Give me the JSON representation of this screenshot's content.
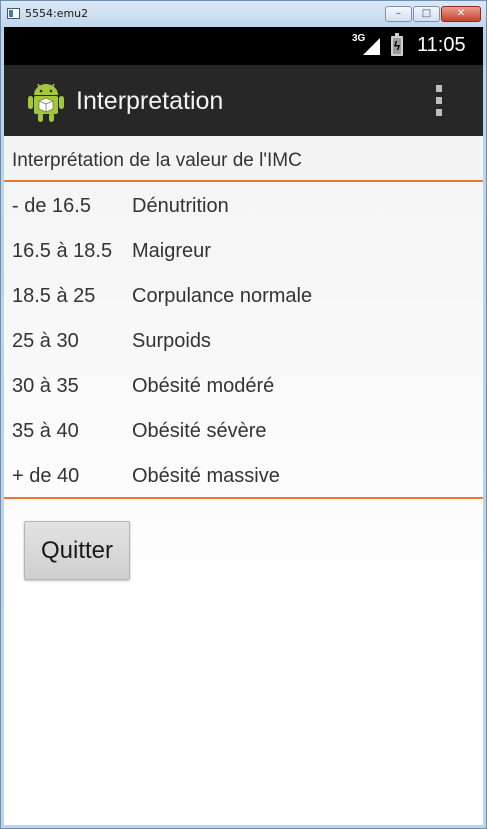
{
  "window": {
    "title": "5554:emu2",
    "min_glyph": "–",
    "max_glyph": "□",
    "close_glyph": "✕"
  },
  "status_bar": {
    "network": "3G",
    "time": "11:05",
    "battery_glyph": "ϟ"
  },
  "action_bar": {
    "title": "Interpretation"
  },
  "content": {
    "section_title": "Interprétation de la valeur de l'IMC",
    "rows": [
      {
        "range": "- de 16.5",
        "label": "Dénutrition"
      },
      {
        "range": "16.5 à 18.5",
        "label": "Maigreur"
      },
      {
        "range": "18.5 à 25",
        "label": "Corpulance normale"
      },
      {
        "range": "25 à 30",
        "label": "Surpoids"
      },
      {
        "range": "30 à 35",
        "label": "Obésité modéré"
      },
      {
        "range": "35 à 40",
        "label": "Obésité sévère"
      },
      {
        "range": "+ de 40",
        "label": "Obésité massive"
      }
    ],
    "quit_button": "Quitter"
  },
  "colors": {
    "accent_divider": "#e8782f",
    "action_bar_bg": "#272727",
    "android_green": "#a4c639"
  }
}
